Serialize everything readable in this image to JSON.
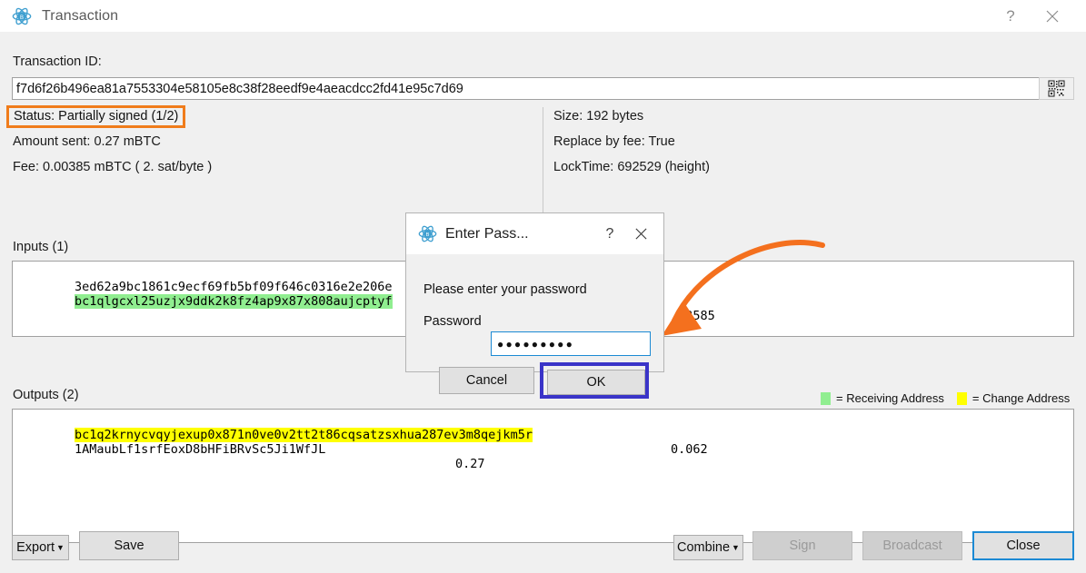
{
  "window": {
    "title": "Transaction",
    "icon": "bitcoin-atom-icon",
    "help_label": "?",
    "close_label": "✕"
  },
  "txid": {
    "label": "Transaction ID:",
    "value": "f7d6f26b496ea81a7553304e58105e8c38f28eedf9e4aeacdcc2fd41e95c7d69",
    "qr_icon": "qr-code-icon"
  },
  "summary_left": {
    "status": "Status: Partially signed (1/2)",
    "amount_sent": "Amount sent: 0.27 mBTC",
    "fee": "Fee: 0.00385 mBTC  ( 2. sat/byte )"
  },
  "summary_right": {
    "size": "Size: 192 bytes",
    "replace_by_fee": "Replace by fee: True",
    "locktime": "LockTime: 692529 (height)"
  },
  "inputs": {
    "header": "Inputs (1)",
    "rows": [
      {
        "text": "3ed62a9bc1861c9ecf69fb5bf09f646c0316e2e206e",
        "highlight": "none",
        "amount": ""
      },
      {
        "text": "bc1qlgcxl25uzjx9ddk2k8fz4ap9x87x808aujcptyf",
        "highlight": "green",
        "amount": ".33585"
      }
    ]
  },
  "outputs": {
    "header": "Outputs (2)",
    "rows": [
      {
        "text": "bc1q2krnycvqyjexup0x871n0ve0v2tt2t86cqsatzsxhua287ev3m8qejkm5r",
        "highlight": "yellow",
        "amount": "0.062"
      },
      {
        "text": "1AMaubLf1srfEoxD8bHFiBRvSc5Ji1WfJL",
        "highlight": "none",
        "amount": "0.27"
      }
    ]
  },
  "legend": {
    "receiving_label": "= Receiving Address",
    "change_label": "= Change Address",
    "receiving_color": "#90ee90",
    "change_color": "#ffff00"
  },
  "buttons": {
    "export": "Export",
    "save": "Save",
    "combine": "Combine",
    "sign": "Sign",
    "broadcast": "Broadcast",
    "close": "Close"
  },
  "dialog": {
    "title": "Enter Pass...",
    "icon": "bitcoin-atom-icon",
    "help_label": "?",
    "close_label": "✕",
    "prompt": "Please enter your password",
    "password_label": "Password",
    "password_value": "●●●●●●●●●",
    "cancel_label": "Cancel",
    "ok_label": "OK"
  },
  "annotations": {
    "status_outline_color": "#f07c1b",
    "arrow_color": "#f4701e",
    "ok_outline_color": "#3a34c8"
  }
}
